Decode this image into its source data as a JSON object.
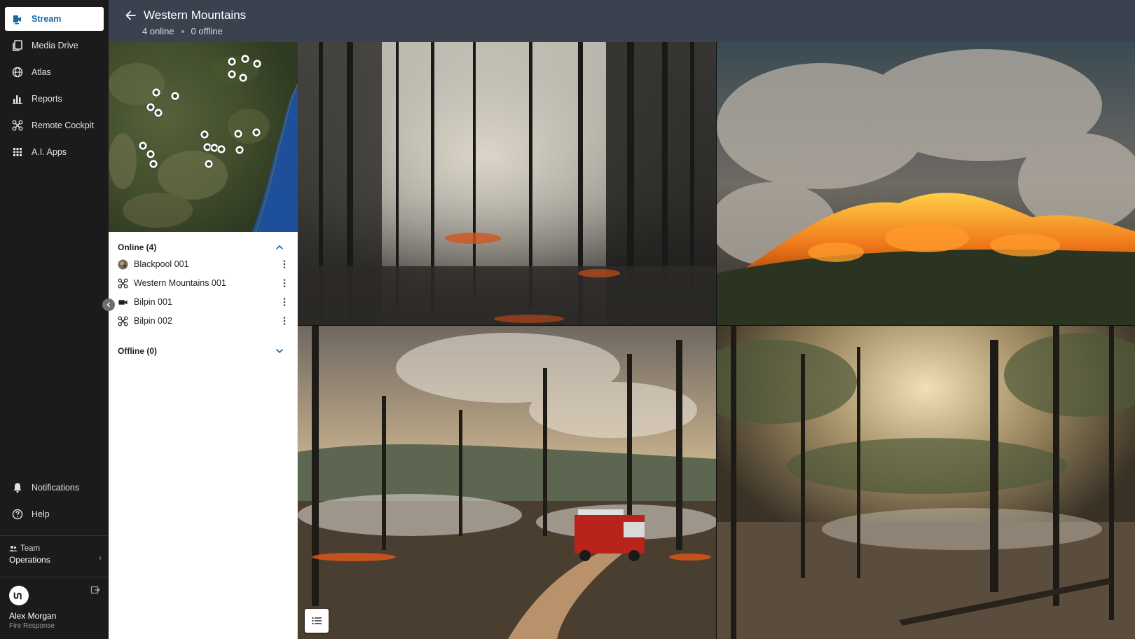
{
  "sidebar": {
    "items": [
      {
        "label": "Stream",
        "icon": "stream-camera-icon",
        "active": true
      },
      {
        "label": "Media Drive",
        "icon": "media-drive-icon"
      },
      {
        "label": "Atlas",
        "icon": "globe-icon"
      },
      {
        "label": "Reports",
        "icon": "bar-chart-icon"
      },
      {
        "label": "Remote Cockpit",
        "icon": "drone-icon"
      },
      {
        "label": "A.I. Apps",
        "icon": "apps-grid-icon"
      }
    ],
    "bottom_items": [
      {
        "label": "Notifications",
        "icon": "bell-icon"
      },
      {
        "label": "Help",
        "icon": "help-circle-icon"
      }
    ],
    "team": {
      "label": "Team",
      "name": "Operations"
    },
    "user": {
      "name": "Alex Morgan",
      "role": "Fire Response"
    }
  },
  "header": {
    "title": "Western Mountains",
    "online_text": "4 online",
    "offline_text": "0 offline"
  },
  "devices": {
    "online_header": "Online (4)",
    "offline_header": "Offline (0)",
    "online": [
      {
        "name": "Blackpool 001",
        "icon": "avatar-icon"
      },
      {
        "name": "Western Mountains 001",
        "icon": "drone-icon"
      },
      {
        "name": "Bilpin 001",
        "icon": "video-camera-icon"
      },
      {
        "name": "Bilpin 002",
        "icon": "drone-icon"
      }
    ]
  },
  "colors": {
    "accent": "#1768a6",
    "header_bg": "#3a4250",
    "sidebar_bg": "#1b1b1b"
  }
}
